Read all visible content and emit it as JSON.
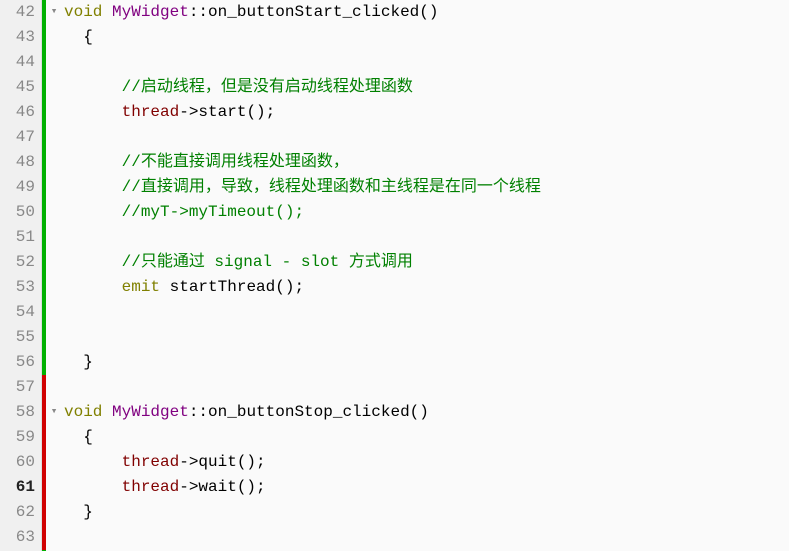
{
  "lines": [
    {
      "num": 42,
      "marker": "green",
      "fold": "▾",
      "tokens": [
        {
          "cls": "kw",
          "t": "void "
        },
        {
          "cls": "cls",
          "t": "MyWidget"
        },
        {
          "cls": "punc",
          "t": "::"
        },
        {
          "cls": "fn",
          "t": "on_buttonStart_clicked"
        },
        {
          "cls": "punc",
          "t": "()"
        }
      ]
    },
    {
      "num": 43,
      "marker": "green",
      "fold": "",
      "tokens": [
        {
          "cls": "",
          "t": "  {"
        }
      ]
    },
    {
      "num": 44,
      "marker": "green",
      "fold": "",
      "tokens": []
    },
    {
      "num": 45,
      "marker": "green",
      "fold": "",
      "tokens": [
        {
          "cls": "",
          "t": "      "
        },
        {
          "cls": "cmt",
          "t": "//启动线程，但是没有启动线程处理函数"
        }
      ]
    },
    {
      "num": 46,
      "marker": "green",
      "fold": "",
      "tokens": [
        {
          "cls": "",
          "t": "      "
        },
        {
          "cls": "var",
          "t": "thread"
        },
        {
          "cls": "punc",
          "t": "->"
        },
        {
          "cls": "fn",
          "t": "start"
        },
        {
          "cls": "punc",
          "t": "();"
        }
      ]
    },
    {
      "num": 47,
      "marker": "green",
      "fold": "",
      "tokens": []
    },
    {
      "num": 48,
      "marker": "green",
      "fold": "",
      "tokens": [
        {
          "cls": "",
          "t": "      "
        },
        {
          "cls": "cmt",
          "t": "//不能直接调用线程处理函数，"
        }
      ]
    },
    {
      "num": 49,
      "marker": "green",
      "fold": "",
      "tokens": [
        {
          "cls": "",
          "t": "      "
        },
        {
          "cls": "cmt",
          "t": "//直接调用，导致，线程处理函数和主线程是在同一个线程"
        }
      ]
    },
    {
      "num": 50,
      "marker": "green",
      "fold": "",
      "tokens": [
        {
          "cls": "",
          "t": "      "
        },
        {
          "cls": "cmt",
          "t": "//myT->myTimeout();"
        }
      ]
    },
    {
      "num": 51,
      "marker": "green",
      "fold": "",
      "tokens": []
    },
    {
      "num": 52,
      "marker": "green",
      "fold": "",
      "tokens": [
        {
          "cls": "",
          "t": "      "
        },
        {
          "cls": "cmt",
          "t": "//只能通过 signal - slot 方式调用"
        }
      ]
    },
    {
      "num": 53,
      "marker": "green",
      "fold": "",
      "tokens": [
        {
          "cls": "",
          "t": "      "
        },
        {
          "cls": "kw",
          "t": "emit"
        },
        {
          "cls": "",
          "t": " "
        },
        {
          "cls": "fn",
          "t": "startThread"
        },
        {
          "cls": "punc",
          "t": "();"
        }
      ]
    },
    {
      "num": 54,
      "marker": "green",
      "fold": "",
      "tokens": []
    },
    {
      "num": 55,
      "marker": "green",
      "fold": "",
      "tokens": []
    },
    {
      "num": 56,
      "marker": "green",
      "fold": "",
      "tokens": [
        {
          "cls": "",
          "t": "  }"
        }
      ]
    },
    {
      "num": 57,
      "marker": "red",
      "fold": "",
      "tokens": []
    },
    {
      "num": 58,
      "marker": "red",
      "fold": "▾",
      "tokens": [
        {
          "cls": "kw",
          "t": "void "
        },
        {
          "cls": "cls",
          "t": "MyWidget"
        },
        {
          "cls": "punc",
          "t": "::"
        },
        {
          "cls": "fn",
          "t": "on_buttonStop_clicked"
        },
        {
          "cls": "punc",
          "t": "()"
        }
      ]
    },
    {
      "num": 59,
      "marker": "red",
      "fold": "",
      "tokens": [
        {
          "cls": "",
          "t": "  {"
        }
      ]
    },
    {
      "num": 60,
      "marker": "red",
      "fold": "",
      "tokens": [
        {
          "cls": "",
          "t": "      "
        },
        {
          "cls": "var",
          "t": "thread"
        },
        {
          "cls": "punc",
          "t": "->"
        },
        {
          "cls": "fn",
          "t": "quit"
        },
        {
          "cls": "punc",
          "t": "();"
        }
      ]
    },
    {
      "num": 61,
      "marker": "red",
      "fold": "",
      "current": true,
      "tokens": [
        {
          "cls": "",
          "t": "      "
        },
        {
          "cls": "var",
          "t": "thread"
        },
        {
          "cls": "punc",
          "t": "->"
        },
        {
          "cls": "fn",
          "t": "wait"
        },
        {
          "cls": "punc",
          "t": "();"
        }
      ]
    },
    {
      "num": 62,
      "marker": "red",
      "fold": "",
      "tokens": [
        {
          "cls": "",
          "t": "  }"
        }
      ]
    },
    {
      "num": 63,
      "marker": "red",
      "fold": "",
      "tokens": []
    }
  ]
}
